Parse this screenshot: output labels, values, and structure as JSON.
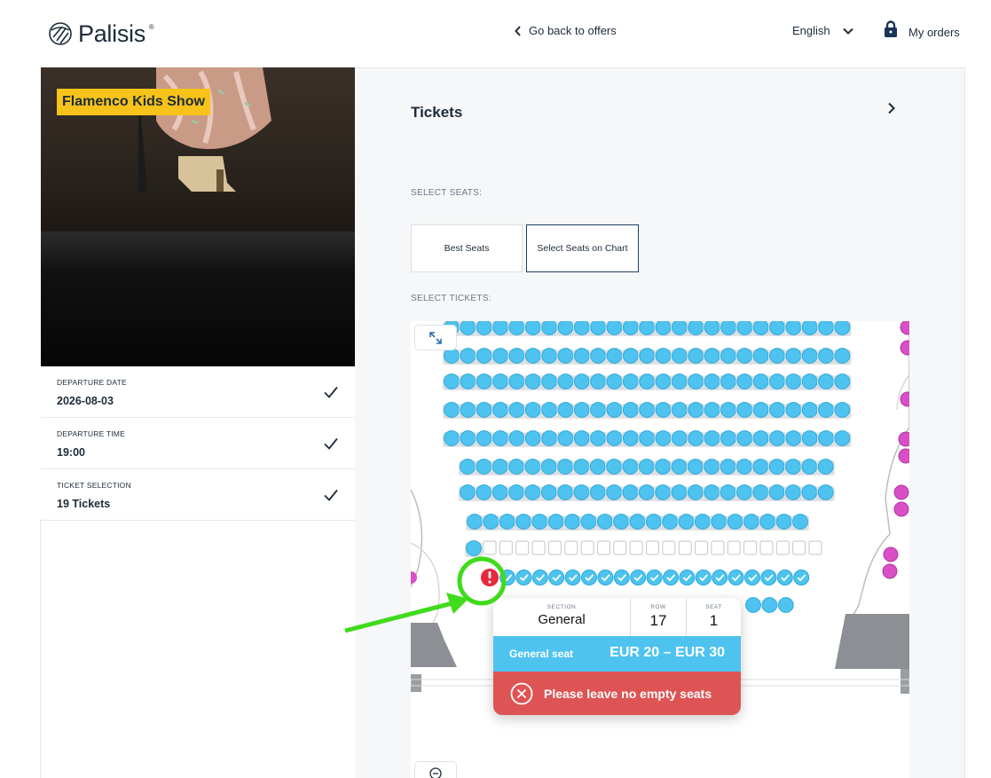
{
  "header": {
    "brand": "Palisis",
    "back_link": "Go back to offers",
    "language": "English",
    "orders": "My orders"
  },
  "event": {
    "title": "Flamenco Kids Show"
  },
  "steps": [
    {
      "label": "DEPARTURE DATE",
      "value": "2026-08-03"
    },
    {
      "label": "DEPARTURE TIME",
      "value": "19:00"
    },
    {
      "label": "TICKET SELECTION",
      "value": "19 Tickets"
    }
  ],
  "main": {
    "title": "Tickets",
    "select_seats_label": "SELECT SEATS:",
    "options": [
      {
        "label": "Best Seats",
        "active": false
      },
      {
        "label": "Select Seats on Chart",
        "active": true
      }
    ],
    "select_tickets_label": "SELECT TICKETS:"
  },
  "seat_tooltip": {
    "section_key": "SECTION",
    "section": "General",
    "row_key": "ROW",
    "row": "17",
    "seat_key": "SEAT",
    "seat": "1",
    "category": "General seat",
    "price_range": "EUR 20 – EUR 30",
    "error": "Please leave no empty seats"
  },
  "colors": {
    "available_seat": "#4ec3ef",
    "selected_seat": "#4ec3ef",
    "other_section_seat": "#d94fc6",
    "error_red": "#de5454",
    "alert_red": "#e8283c",
    "badge_yellow": "#f7c31a",
    "annotation_green": "#3fdb1c"
  },
  "icons": {
    "back": "chevron-left-icon",
    "language": "chevron-down-icon",
    "orders": "lock-icon",
    "next": "chevron-right-icon",
    "step_done": "check-icon",
    "expand": "expand-icon",
    "zoom_out": "zoom-out-icon",
    "seat_alert": "exclamation-icon",
    "error": "close-circle-icon"
  }
}
